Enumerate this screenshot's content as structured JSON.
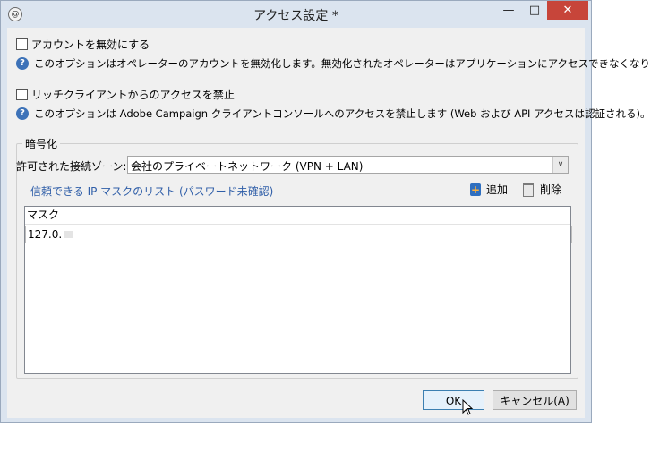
{
  "window": {
    "title": "アクセス設定 *",
    "app_icon": "@",
    "minimize": "—",
    "maximize": "□",
    "close": "✕"
  },
  "options": [
    {
      "label": "アカウントを無効にする",
      "checked": false,
      "help": "このオプションはオペレーターのアカウントを無効化します。無効化されたオペレーターはアプリケーションにアクセスできなくなります。"
    },
    {
      "label": "リッチクライアントからのアクセスを禁止",
      "checked": false,
      "help": "このオプションは Adobe Campaign クライアントコンソールへのアクセスを禁止します (Web および API アクセスは認証される)。"
    }
  ],
  "help_icon_glyph": "?",
  "encryption": {
    "group_title": "暗号化",
    "zone_label": "許可された接続ゾーン:",
    "zone_value": "会社のプライベートネットワーク (VPN + LAN)",
    "dropdown_arrow": "∨",
    "list_title": "信頼できる IP マスクのリスト (パスワード未確認)",
    "add_label": "追加",
    "delete_label": "削除",
    "table": {
      "columns": [
        "マスク"
      ],
      "rows": [
        [
          "127.0."
        ]
      ]
    }
  },
  "buttons": {
    "ok": "OK",
    "cancel": "キャンセル(A)"
  },
  "icons": {
    "add": "add-icon",
    "delete": "trash-icon",
    "help": "question-icon"
  }
}
